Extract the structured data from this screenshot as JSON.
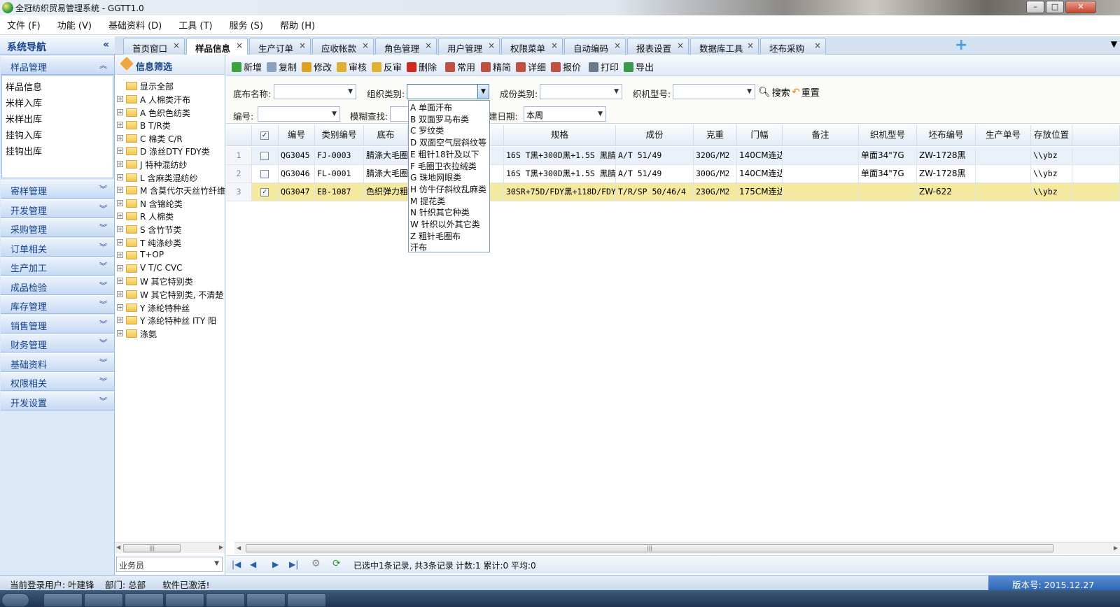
{
  "window": {
    "title": "全冠纺织贸易管理系统 - GGTT1.0",
    "minimize": "–",
    "maximize": "□",
    "close": "✕"
  },
  "menubar": [
    "文件 (F)",
    "功能 (V)",
    "基础资料 (D)",
    "工具 (T)",
    "服务 (S)",
    "帮助 (H)"
  ],
  "nav": {
    "title": "系统导航",
    "collapse": "«",
    "active_section": "样品管理",
    "sub_items": [
      "样品信息",
      "米样入库",
      "米样出库",
      "挂钩入库",
      "挂钩出库"
    ],
    "sections": [
      "寄样管理",
      "开发管理",
      "采购管理",
      "订单相关",
      "生产加工",
      "成品检验",
      "库存管理",
      "销售管理",
      "财务管理",
      "基础资料",
      "权限相关",
      "开发设置"
    ]
  },
  "tabs": [
    "首页窗口",
    "样品信息",
    "生产订单",
    "应收帐款",
    "角色管理",
    "用户管理",
    "权限菜单",
    "自动编码",
    "报表设置",
    "数据库工具",
    "坯布采购"
  ],
  "tab_active_index": 1,
  "tree": {
    "title": "信息筛选",
    "root": "显示全部",
    "nodes": [
      "A  人棉类汗布",
      "A  色织色纺类",
      "B  T/R类",
      "C  棉类  C/R",
      "D  涤丝DTY FDY类",
      "J  特种混纺纱",
      "L  含麻类混纺纱",
      "M  含莫代尔天丝竹纤维",
      "N  含锦纶类",
      "R  人棉类",
      "S  含竹节类",
      "T  纯涤纱类",
      "T+OP",
      "V  T/C CVC",
      "W  其它特别类",
      "W  其它特别类, 不清楚",
      "Y  涤纶特种丝",
      "Y  涤纶特种丝 ITY 阳",
      "涤氨"
    ],
    "salesman_placeholder": "业务员"
  },
  "toolbar": [
    {
      "label": "新增",
      "color": "#3aa43a"
    },
    {
      "label": "复制",
      "color": "#8aa2c0"
    },
    {
      "label": "修改",
      "color": "#e0a020"
    },
    {
      "label": "审核",
      "color": "#e0b030"
    },
    {
      "label": "反审",
      "color": "#e0b030"
    },
    {
      "label": "删除",
      "color": "#d02a1e"
    },
    {
      "label": "常用",
      "color": "#c05040"
    },
    {
      "label": "精简",
      "color": "#c05040"
    },
    {
      "label": "详细",
      "color": "#c05040"
    },
    {
      "label": "报价",
      "color": "#c05040"
    },
    {
      "label": "打印",
      "color": "#6a7a8a"
    },
    {
      "label": "导出",
      "color": "#3a9a4a"
    }
  ],
  "filter": {
    "cloth_name_label": "底布名称:",
    "org_label": "组织类别:",
    "comp_label": "成份类别:",
    "machine_label": "织机型号:",
    "code_label": "编号:",
    "fuzzy_label": "模糊查找:",
    "date_label": "建日期:",
    "date_value": "本周",
    "search": "搜索",
    "reset": "重置"
  },
  "org_dropdown": [
    "A  单面汗布",
    "B  双面罗马布类",
    "C  罗纹类",
    "D  双面空气层斜纹等",
    "E  粗针18针及以下",
    "F  毛圈卫衣拉绒类",
    "G  珠地网眼类",
    "H  仿牛仔斜纹乱麻类",
    "M  提花类",
    "N  针织其它种类",
    "W  针织以外其它类",
    "Z  粗针毛圈布",
    "汗布"
  ],
  "grid": {
    "columns": [
      "",
      "",
      "编号",
      "类别编号",
      "底布",
      "艺",
      "规格",
      "成份",
      "克重",
      "门幅",
      "备注",
      "织机型号",
      "坯布编号",
      "生产单号",
      "存放位置",
      ""
    ],
    "rows": [
      {
        "num": "1",
        "checked": "",
        "code": "QG3045",
        "cat": "FJ-0003",
        "cloth": "腈涤大毛圈",
        "spec": "16S T黑+300D黑+1.5S 黑腈",
        "comp": "A/T 51/49",
        "weight": "320G/M2",
        "width": "140CM连边",
        "note": "",
        "machine": "单面34\"7G",
        "grey": "ZW-1728黑",
        "prod": "",
        "loc": "\\\\ybz"
      },
      {
        "num": "2",
        "checked": "",
        "code": "QG3046",
        "cat": "FL-0001",
        "cloth": "腈涤大毛圈",
        "spec": "16S T黑+300D黑+1.5S 黑腈",
        "comp": "A/T 51/49",
        "weight": "300G/M2",
        "width": "140CM连边",
        "note": "",
        "machine": "单面34\"7G",
        "grey": "ZW-1728黑",
        "prod": "",
        "loc": "\\\\ybz"
      },
      {
        "num": "3",
        "checked": "✓",
        "code": "QG3047",
        "cat": "EB-1087",
        "cloth": "色织弹力粗",
        "spec": "30SR+75D/FDY黑+118D/FDY/4",
        "comp": "T/R/SP 50/46/4",
        "weight": "230G/M2",
        "width": "175CM连边",
        "note": "",
        "machine": "",
        "grey": "ZW-622",
        "prod": "",
        "loc": "\\\\ybz"
      }
    ],
    "header_check": "✓"
  },
  "pager": {
    "first": "◀",
    "prev": "◀",
    "next": "▶",
    "last": "▶",
    "info": "已选中1条记录, 共3条记录",
    "stats": "计数:1 累计:0 平均:0"
  },
  "status": {
    "user": "当前登录用户: 叶建锋",
    "dept": "部门: 总部",
    "activated": "软件已激活!",
    "version": "版本号: 2015.12.27"
  },
  "colors": {
    "selected_row": "#f5e9a0",
    "alt_row": "#eaf0fa",
    "nav_bg": "#dbe8f8",
    "accent": "#15428b"
  }
}
